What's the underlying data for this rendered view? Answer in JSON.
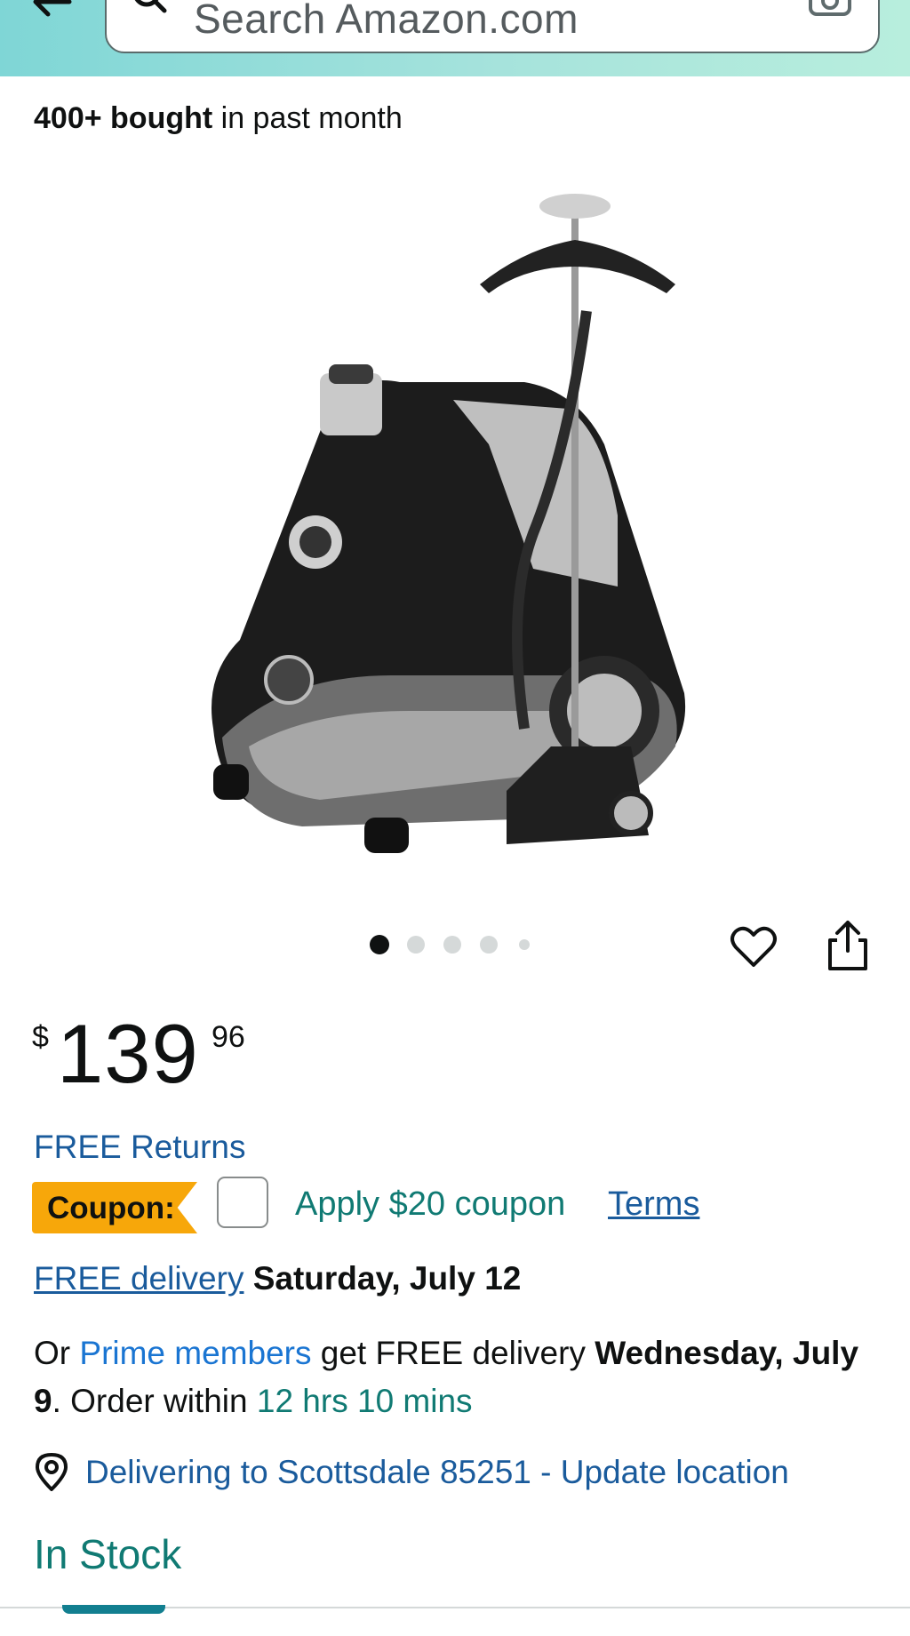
{
  "header": {
    "search_placeholder": "Search Amazon.com",
    "colors": {
      "gradient_start": "#7fd6d6",
      "gradient_end": "#b8eedd"
    }
  },
  "bought": {
    "count": "400+ bought",
    "suffix": " in past month"
  },
  "product": {
    "image_alt": "Garment steamer with hanger stand"
  },
  "carousel": {
    "count": 5,
    "active_index": 0
  },
  "price": {
    "symbol": "$",
    "whole": "139",
    "fraction": "96"
  },
  "free_returns": "FREE Returns",
  "coupon": {
    "badge": "Coupon:",
    "apply": "Apply $20 coupon",
    "terms": "Terms",
    "checked": false
  },
  "delivery": {
    "free_delivery_link": "FREE delivery",
    "date": "Saturday, July 12"
  },
  "prime": {
    "or": "Or ",
    "prime_members": "Prime members",
    "get_free": " get FREE delivery ",
    "prime_date": "Wednesday, July 9",
    "order_within": ". Order within ",
    "countdown": "12 hrs 10 mins"
  },
  "location": {
    "text": "Delivering to Scottsdale 85251 - Update location"
  },
  "stock": {
    "status": "In Stock"
  },
  "icons": {
    "back": "back-arrow-icon",
    "search": "search-icon",
    "camera": "camera-scan-icon",
    "heart": "heart-icon",
    "share": "share-icon",
    "location": "location-pin-icon"
  },
  "colors": {
    "link_blue": "#1a5b9c",
    "prime_blue": "#1a75d2",
    "teal_green": "#107a73",
    "coupon_orange": "#f7a70a",
    "tab_indicator": "#127f90"
  }
}
